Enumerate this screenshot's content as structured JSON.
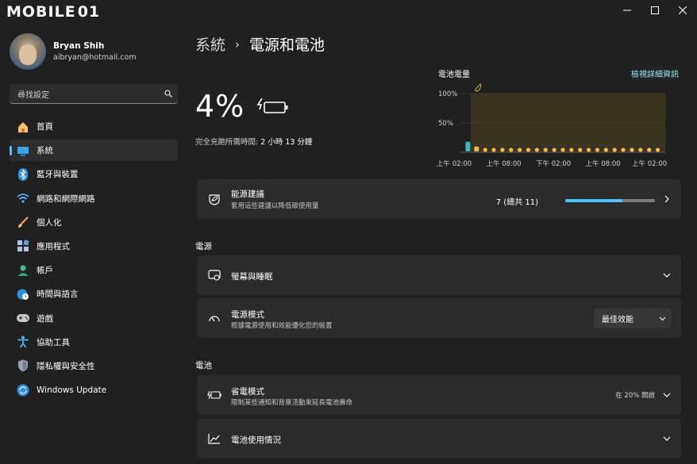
{
  "window": {
    "logo_text": "MOBILE",
    "logo_suffix": "01"
  },
  "profile": {
    "name": "Bryan Shih",
    "email": "aibryan@hotmail.com"
  },
  "search": {
    "placeholder": "尋找設定"
  },
  "nav": {
    "items": [
      {
        "label": "首頁",
        "icon": "home-icon"
      },
      {
        "label": "系統",
        "icon": "system-icon",
        "active": true
      },
      {
        "label": "藍牙與裝置",
        "icon": "bluetooth-icon"
      },
      {
        "label": "網路和網際網路",
        "icon": "wifi-icon"
      },
      {
        "label": "個人化",
        "icon": "brush-icon"
      },
      {
        "label": "應用程式",
        "icon": "apps-icon"
      },
      {
        "label": "帳戶",
        "icon": "account-icon"
      },
      {
        "label": "時間與語言",
        "icon": "globe-clock-icon"
      },
      {
        "label": "遊戲",
        "icon": "gamepad-icon"
      },
      {
        "label": "協助工具",
        "icon": "accessibility-icon"
      },
      {
        "label": "隱私權與安全性",
        "icon": "shield-icon"
      },
      {
        "label": "Windows Update",
        "icon": "update-icon"
      }
    ]
  },
  "breadcrumb": {
    "parent": "系統",
    "separator": "›",
    "current": "電源和電池"
  },
  "battery": {
    "percent_text": "4%",
    "full_charge_label": "完全充飽所需時間:",
    "full_charge_time": "2 小時 13 分鐘"
  },
  "chart": {
    "title": "電池電量",
    "link": "檢視詳細資訊",
    "ytick_100": "100%",
    "ytick_50": "50%",
    "xticks": [
      "上午 02:00",
      "上午 08:00",
      "下午 02:00",
      "上午 08:00",
      "上午 02:00"
    ]
  },
  "chart_data": {
    "type": "bar",
    "title": "電池電量",
    "ylim": [
      0,
      100
    ],
    "yticks": [
      "100%",
      "50%"
    ],
    "xticks": [
      "上午 02:00",
      "上午 08:00",
      "下午 02:00",
      "上午 08:00",
      "上午 02:00"
    ],
    "values": [
      18,
      10,
      4,
      4,
      4,
      4,
      4,
      4,
      4,
      4,
      4,
      4,
      4,
      4,
      4,
      4,
      4,
      4,
      4,
      4,
      4,
      4,
      4
    ],
    "colors": {
      "normal": "#3fb8c4",
      "saver": "#f2b84b",
      "saver_zone": "#3a3320"
    },
    "grid": true
  },
  "energy": {
    "title": "能源建議",
    "subtitle": "套用這些建議以降低碳使用量",
    "count_text": "7 (總共 11)",
    "progress": 0.636
  },
  "power_section": {
    "label": "電源",
    "screen_sleep": {
      "title": "螢幕與睡眠"
    },
    "power_mode": {
      "title": "電源模式",
      "subtitle": "根據電源使用和效能優化您的裝置",
      "value": "最佳效能"
    }
  },
  "battery_section": {
    "label": "電池",
    "saver": {
      "title": "省電模式",
      "subtitle": "限制某些通知和背景活動來延長電池壽命",
      "status": "在 20% 開啟"
    },
    "usage": {
      "title": "電池使用情況"
    }
  },
  "colors": {
    "accent": "#4cc2ff",
    "background": "#202020",
    "card": "#2b2b2b",
    "saver": "#f2b84b"
  }
}
